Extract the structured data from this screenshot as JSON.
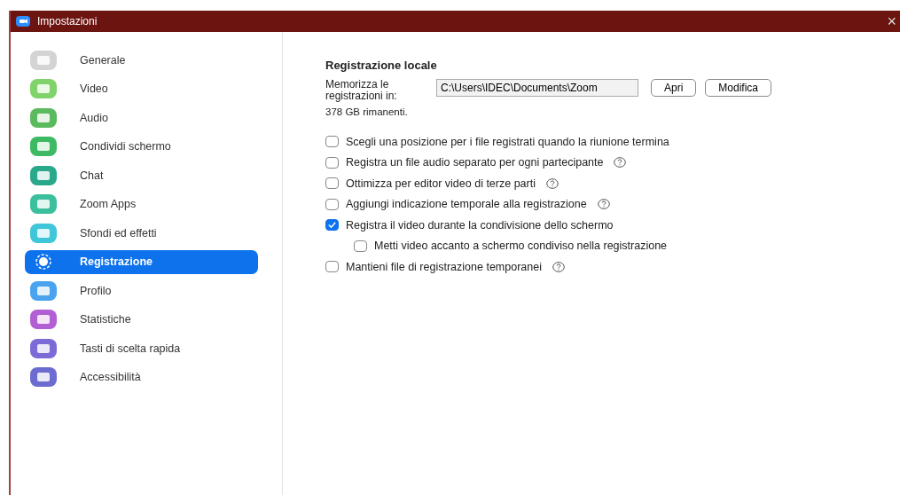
{
  "window": {
    "title": "Impostazioni",
    "close": "×"
  },
  "sidebar": {
    "items": [
      {
        "label": "Generale",
        "selected": false,
        "color": "#d4d4d4"
      },
      {
        "label": "Video",
        "selected": false,
        "color": "#7fd36a"
      },
      {
        "label": "Audio",
        "selected": false,
        "color": "#5bb95e"
      },
      {
        "label": "Condividi schermo",
        "selected": false,
        "color": "#3fba64"
      },
      {
        "label": "Chat",
        "selected": false,
        "color": "#2aa88c"
      },
      {
        "label": "Zoom Apps",
        "selected": false,
        "color": "#3cbf9c"
      },
      {
        "label": "Sfondi ed effetti",
        "selected": false,
        "color": "#3fc6d8"
      },
      {
        "label": "Registrazione",
        "selected": true,
        "color": "#ffffff"
      },
      {
        "label": "Profilo",
        "selected": false,
        "color": "#4aa3ef"
      },
      {
        "label": "Statistiche",
        "selected": false,
        "color": "#b25fd4"
      },
      {
        "label": "Tasti di scelta rapida",
        "selected": false,
        "color": "#7c6ad6"
      },
      {
        "label": "Accessibilità",
        "selected": false,
        "color": "#6c6cd0"
      }
    ]
  },
  "content": {
    "heading": "Registrazione locale",
    "location": {
      "label": "Memorizza le registrazioni in:",
      "path": "C:\\Users\\IDEC\\Documents\\Zoom",
      "buttons": [
        "Apri",
        "Modifica"
      ]
    },
    "space": "378 GB rimanenti.",
    "options": [
      {
        "label": "Scegli una posizione per i file registrati quando la riunione termina",
        "checked": false,
        "help": false
      },
      {
        "label": "Registra un file audio separato per ogni partecipante",
        "checked": false,
        "help": true
      },
      {
        "label": "Ottimizza per editor video di terze parti",
        "checked": false,
        "help": true
      },
      {
        "label": "Aggiungi indicazione temporale alla registrazione",
        "checked": false,
        "help": true
      },
      {
        "label": "Registra il video durante la condivisione dello schermo",
        "checked": true,
        "help": false,
        "children": [
          {
            "label": "Metti video accanto a schermo condiviso nella registrazione",
            "checked": false,
            "help": false
          }
        ]
      },
      {
        "label": "Mantieni file di registrazione temporanei",
        "checked": false,
        "help": true
      }
    ]
  }
}
